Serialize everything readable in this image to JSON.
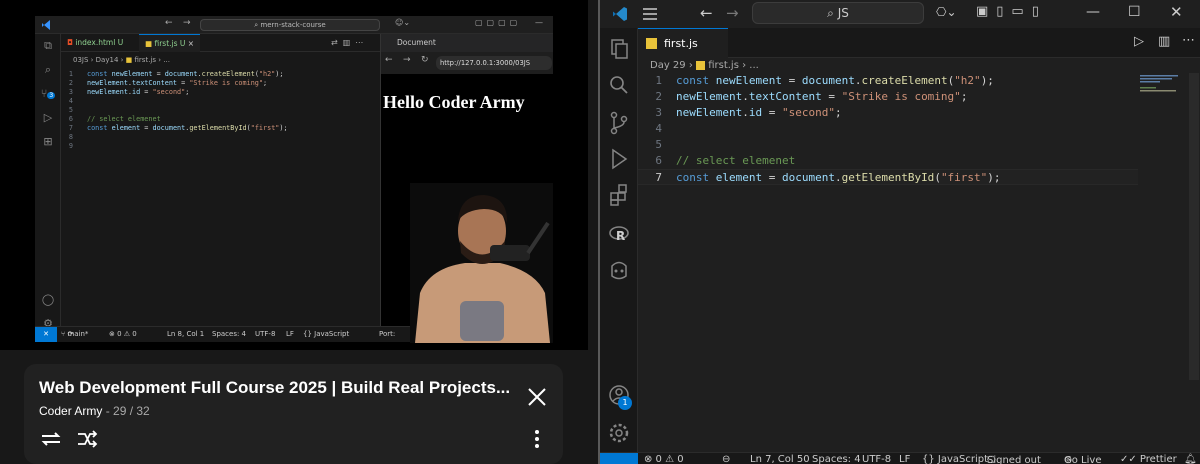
{
  "left_video": {
    "vscode": {
      "search_text": "mern-stack-course",
      "tabs": [
        {
          "label": "index.html",
          "badge": "U"
        },
        {
          "label": "first.js",
          "badge": "U"
        }
      ],
      "breadcrumb": [
        "03JS",
        "Day14",
        "first.js",
        "..."
      ],
      "lines": [
        {
          "n": "1",
          "code": "const newElement = document.createElement(\"h2\");"
        },
        {
          "n": "2",
          "code": "newElement.textContent = \"Strike is coming\";"
        },
        {
          "n": "3",
          "code": "newElement.id = \"second\";"
        },
        {
          "n": "4",
          "code": ""
        },
        {
          "n": "5",
          "code": ""
        },
        {
          "n": "6",
          "code": "// select elemenet"
        },
        {
          "n": "7",
          "code": "const element = document.getElementById(\"first\");"
        },
        {
          "n": "8",
          "code": ""
        },
        {
          "n": "9",
          "code": ""
        }
      ],
      "scm_badge": "3",
      "browser": {
        "tab_label": "Document",
        "url": "http://127.0.0.1:3000/03JS",
        "heading": "Hello Coder Army"
      },
      "status": {
        "branch": "main*",
        "problems": "⊗ 0 ⚠ 0",
        "position": "Ln 8, Col 1",
        "spaces": "Spaces: 4",
        "encoding": "UTF-8",
        "eol": "LF",
        "language": "{} JavaScript",
        "port": "Port:"
      }
    }
  },
  "playlist": {
    "title": "Web Development Full Course 2025 | Build Real Projects...",
    "channel": "Coder Army",
    "position": " - 29 / 32"
  },
  "right_editor": {
    "search_text": "JS",
    "tab_label": "first.js",
    "breadcrumb": [
      "Day 29",
      "first.js",
      "..."
    ],
    "lines": [
      {
        "n": "1",
        "code": "const newElement = document.createElement(\"h2\");"
      },
      {
        "n": "2",
        "code": "newElement.textContent = \"Strike is coming\";"
      },
      {
        "n": "3",
        "code": "newElement.id = \"second\";"
      },
      {
        "n": "4",
        "code": ""
      },
      {
        "n": "5",
        "code": ""
      },
      {
        "n": "6",
        "code": "// select elemenet"
      },
      {
        "n": "7",
        "code": "const element = document.getElementById(\"first\");"
      }
    ],
    "current_line": "7",
    "accounts_badge": "1",
    "status": {
      "problems": "⊗ 0 ⚠ 0",
      "position": "Ln 7, Col 50",
      "spaces": "Spaces: 4",
      "encoding": "UTF-8",
      "eol": "LF",
      "language": "{} JavaScript",
      "signed_out": "Signed out",
      "go_live": "Go Live",
      "prettier": "✓✓ Prettier"
    }
  },
  "colors": {
    "accent": "#0078d4",
    "keyword": "#569cd6",
    "variable": "#9cdcfe",
    "function": "#dcdcaa",
    "string": "#ce9178",
    "comment": "#6a9955"
  }
}
